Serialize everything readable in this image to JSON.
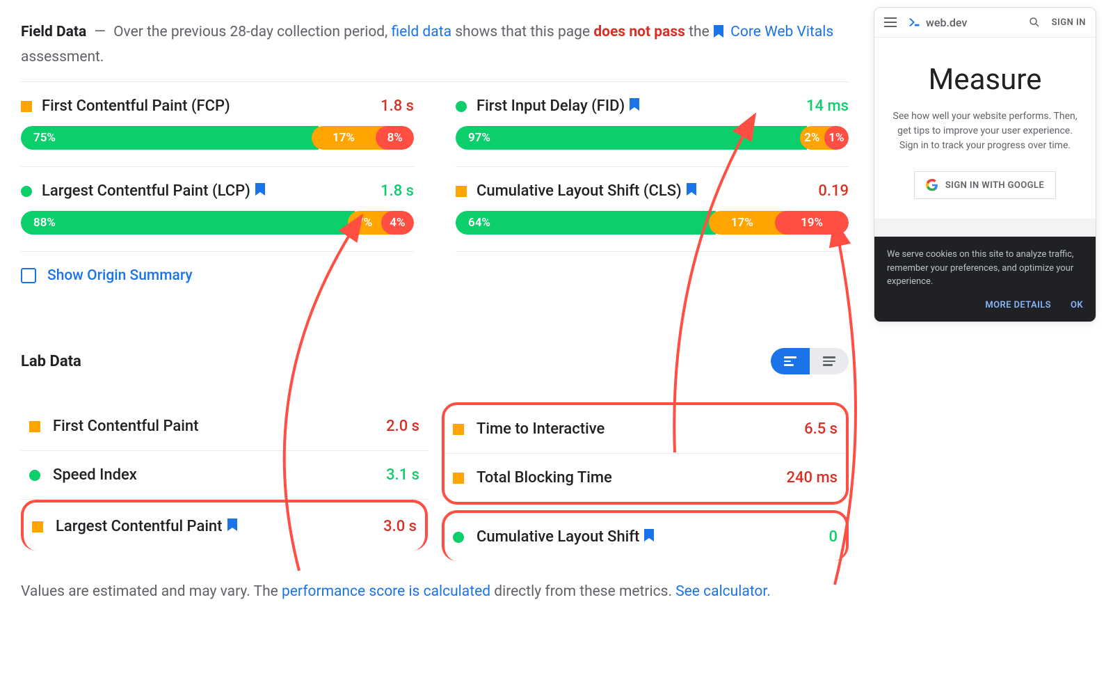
{
  "fieldData": {
    "heading": "Field Data",
    "prefix": "Over the previous 28-day collection period,",
    "linkFieldData": "field data",
    "middle": "shows that this page",
    "failText": "does not pass",
    "suffix1": "the",
    "cwvLink": "Core Web Vitals",
    "suffix2": "assessment."
  },
  "metrics": {
    "fcp": {
      "name": "First Contentful Paint (FCP)",
      "value": "1.8 s",
      "good": "75%",
      "mid": "17%",
      "bad": "8%"
    },
    "fid": {
      "name": "First Input Delay (FID)",
      "value": "14 ms",
      "good": "97%",
      "mid": "2%",
      "bad": "1%"
    },
    "lcp": {
      "name": "Largest Contentful Paint (LCP)",
      "value": "1.8 s",
      "good": "88%",
      "mid": "7%",
      "bad": "4%"
    },
    "cls": {
      "name": "Cumulative Layout Shift (CLS)",
      "value": "0.19",
      "good": "64%",
      "mid": "17%",
      "bad": "19%"
    }
  },
  "originSummary": "Show Origin Summary",
  "labData": {
    "title": "Lab Data",
    "fcp": {
      "name": "First Contentful Paint",
      "value": "2.0 s"
    },
    "si": {
      "name": "Speed Index",
      "value": "3.1 s"
    },
    "lcp": {
      "name": "Largest Contentful Paint",
      "value": "3.0 s"
    },
    "tti": {
      "name": "Time to Interactive",
      "value": "6.5 s"
    },
    "tbt": {
      "name": "Total Blocking Time",
      "value": "240 ms"
    },
    "cls": {
      "name": "Cumulative Layout Shift",
      "value": "0"
    }
  },
  "footer": {
    "prefix": "Values are estimated and may vary. The",
    "link1": "performance score is calculated",
    "middle": "directly from these metrics.",
    "link2": "See calculator."
  },
  "preview": {
    "brand": "web.dev",
    "signIn": "SIGN IN",
    "title": "Measure",
    "desc": "See how well your website performs. Then, get tips to improve your user experience. Sign in to track your progress over time.",
    "signInGoogle": "SIGN IN WITH GOOGLE",
    "cookieText": "We serve cookies on this site to analyze traffic, remember your preferences, and optimize your experience.",
    "moreDetails": "MORE DETAILS",
    "ok": "OK"
  }
}
